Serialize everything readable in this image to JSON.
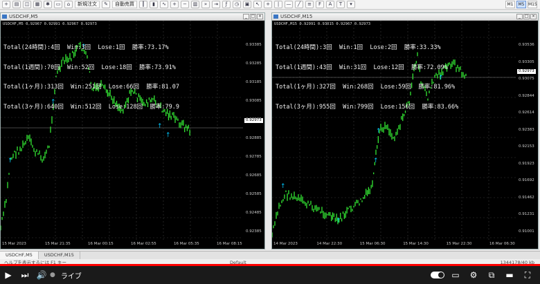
{
  "toolbar": {
    "new_order_label": "新規注文",
    "auto_trading_label": "自動売買",
    "timeframes": [
      "M1",
      "M5",
      "M15"
    ]
  },
  "charts": [
    {
      "title": "USDCHF,M5",
      "symbol_line": "USDCHF,M5  0.92967 0.92991 0.92967 0.92973",
      "stats": [
        "Total(24時間):4回  Win:3回  Lose:1回  勝率:73.17%",
        "Total(1週間):70回  Win:52回  Lose:18回  勝率:73.91%",
        "Total(1ヶ月):313回  Win:251回  Lose:66回  勝率:81.07",
        "Total(3ヶ月):640回  Win:512回  Lose:128回  勝率:79.9"
      ],
      "price_labels": [
        "0.93385",
        "0.93285",
        "0.93185",
        "0.93085",
        "0.92985",
        "0.92885",
        "0.92785",
        "0.92685",
        "0.92585",
        "0.92485",
        "0.92385"
      ],
      "current_price": "0.92973",
      "time_labels": [
        "15 Mar 2023",
        "15 Mar 21:35",
        "16 Mar 00:15",
        "16 Mar 02:55",
        "16 Mar 05:35",
        "16 Mar 08:15"
      ]
    },
    {
      "title": "USDCHF,M15",
      "symbol_line": "USDCHF,M15  0.92991 0.93015 0.92967 0.92973",
      "stats": [
        "Total(24時間):3回  Win:1回  Lose:2回  勝率:33.33%",
        "Total(1週間):43回  Win:31回  Lose:12回  勝率:72.09%",
        "Total(1ヶ月):327回  Win:268回  Lose:59回  勝率:81.96%",
        "Total(3ヶ月):955回  Win:799回  Lose:156回  勝率:83.66%"
      ],
      "price_labels": [
        "0.93536",
        "0.93305",
        "0.93075",
        "0.92844",
        "0.92614",
        "0.92383",
        "0.92153",
        "0.91923",
        "0.91692",
        "0.91462",
        "0.91231",
        "0.91001"
      ],
      "current_price": "0.92973",
      "time_labels": [
        "14 Mar 2023",
        "14 Mar 22:30",
        "15 Mar 06:30",
        "15 Mar 14:30",
        "15 Mar 22:30",
        "16 Mar 06:30"
      ]
    }
  ],
  "tabs": [
    "USDCHF,M5",
    "USDCHF,M15"
  ],
  "status": {
    "left": "ヘルプを表示するには F1 キー",
    "mid": "Default",
    "right": "1344178/40 kb"
  },
  "player": {
    "live_label": "ライブ",
    "progress": 1.0
  }
}
